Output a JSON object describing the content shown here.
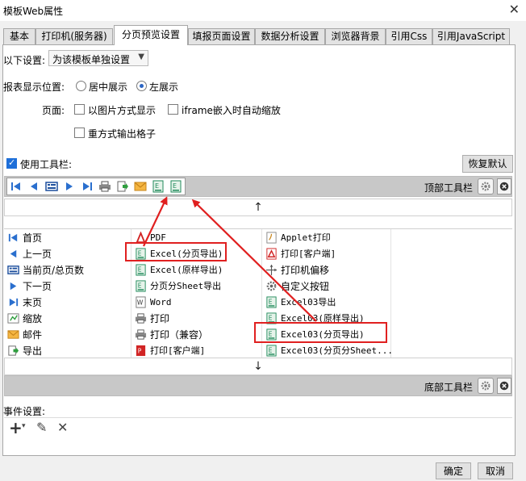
{
  "window": {
    "title": "模板Web属性",
    "close_glyph": "✕"
  },
  "tabs": [
    {
      "label": "基本"
    },
    {
      "label": "打印机(服务器)"
    },
    {
      "label": "分页预览设置"
    },
    {
      "label": "填报页面设置"
    },
    {
      "label": "数据分析设置"
    },
    {
      "label": "浏览器背景"
    },
    {
      "label": "引用Css"
    },
    {
      "label": "引用JavaScript"
    }
  ],
  "active_tab": "分页预览设置",
  "settings": {
    "scope_label": "以下设置:",
    "scope_value": "为该模板单独设置",
    "position_label": "报表显示位置:",
    "position_options": [
      {
        "label": "居中展示",
        "checked": false
      },
      {
        "label": "左展示",
        "checked": true
      }
    ],
    "page_label": "页面:",
    "page_options": [
      {
        "label": "以图片方式显示",
        "checked": false
      },
      {
        "label": "iframe嵌入时自动缩放",
        "checked": false
      },
      {
        "label": "重方式输出格子",
        "checked": false
      }
    ],
    "use_toolbar_label": "使用工具栏:",
    "use_toolbar_checked": true,
    "restore_default": "恢复默认"
  },
  "top_toolbar": {
    "label": "顶部工具栏",
    "icons": [
      "first-page-icon",
      "prev-page-icon",
      "current-total-icon",
      "next-page-icon",
      "last-page-icon",
      "print-icon",
      "export-icon",
      "mail-icon",
      "excel-page-export-icon",
      "excel03-page-export-icon"
    ]
  },
  "bottom_toolbar": {
    "label": "底部工具栏"
  },
  "arrows": {
    "up": "↑",
    "down": "↓"
  },
  "button_columns": [
    [
      {
        "label": "首页",
        "icon": "first-page-icon"
      },
      {
        "label": "上一页",
        "icon": "prev-page-icon"
      },
      {
        "label": "当前页/总页数",
        "icon": "current-total-icon"
      },
      {
        "label": "下一页",
        "icon": "next-page-icon"
      },
      {
        "label": "末页",
        "icon": "last-page-icon"
      },
      {
        "label": "缩放",
        "icon": "zoom-icon"
      },
      {
        "label": "邮件",
        "icon": "mail-icon"
      },
      {
        "label": "导出",
        "icon": "export-icon"
      }
    ],
    [
      {
        "label": "PDF",
        "icon": "pdf-icon"
      },
      {
        "label": "Excel(分页导出)",
        "icon": "excel-icon"
      },
      {
        "label": "Excel(原样导出)",
        "icon": "excel-icon"
      },
      {
        "label": "分页分Sheet导出",
        "icon": "excel-icon"
      },
      {
        "label": "Word",
        "icon": "word-icon"
      },
      {
        "label": "打印",
        "icon": "print-icon"
      },
      {
        "label": "打印（兼容）",
        "icon": "print-icon"
      },
      {
        "label": "打印[客户端]",
        "icon": "pdf-icon"
      }
    ],
    [
      {
        "label": "Applet打印",
        "icon": "applet-icon"
      },
      {
        "label": "打印[客户端]",
        "icon": "pdf-icon"
      },
      {
        "label": "打印机偏移",
        "icon": "offset-icon"
      },
      {
        "label": "自定义按钮",
        "icon": "gear-icon"
      },
      {
        "label": "Excel03导出",
        "icon": "excel-icon"
      },
      {
        "label": "Excel03(原样导出)",
        "icon": "excel-icon"
      },
      {
        "label": "Excel03(分页导出)",
        "icon": "excel-icon"
      },
      {
        "label": "Excel03(分页分Sheet...",
        "icon": "excel-icon"
      }
    ]
  ],
  "events": {
    "label": "事件设置:",
    "tools": [
      "+",
      "▾",
      "✎",
      "✕"
    ]
  },
  "footer": {
    "ok": "确定",
    "cancel": "取消"
  },
  "colors": {
    "highlight": "#e02020",
    "excel_green": "#1f8a5a",
    "nav_blue": "#2a6fce"
  }
}
